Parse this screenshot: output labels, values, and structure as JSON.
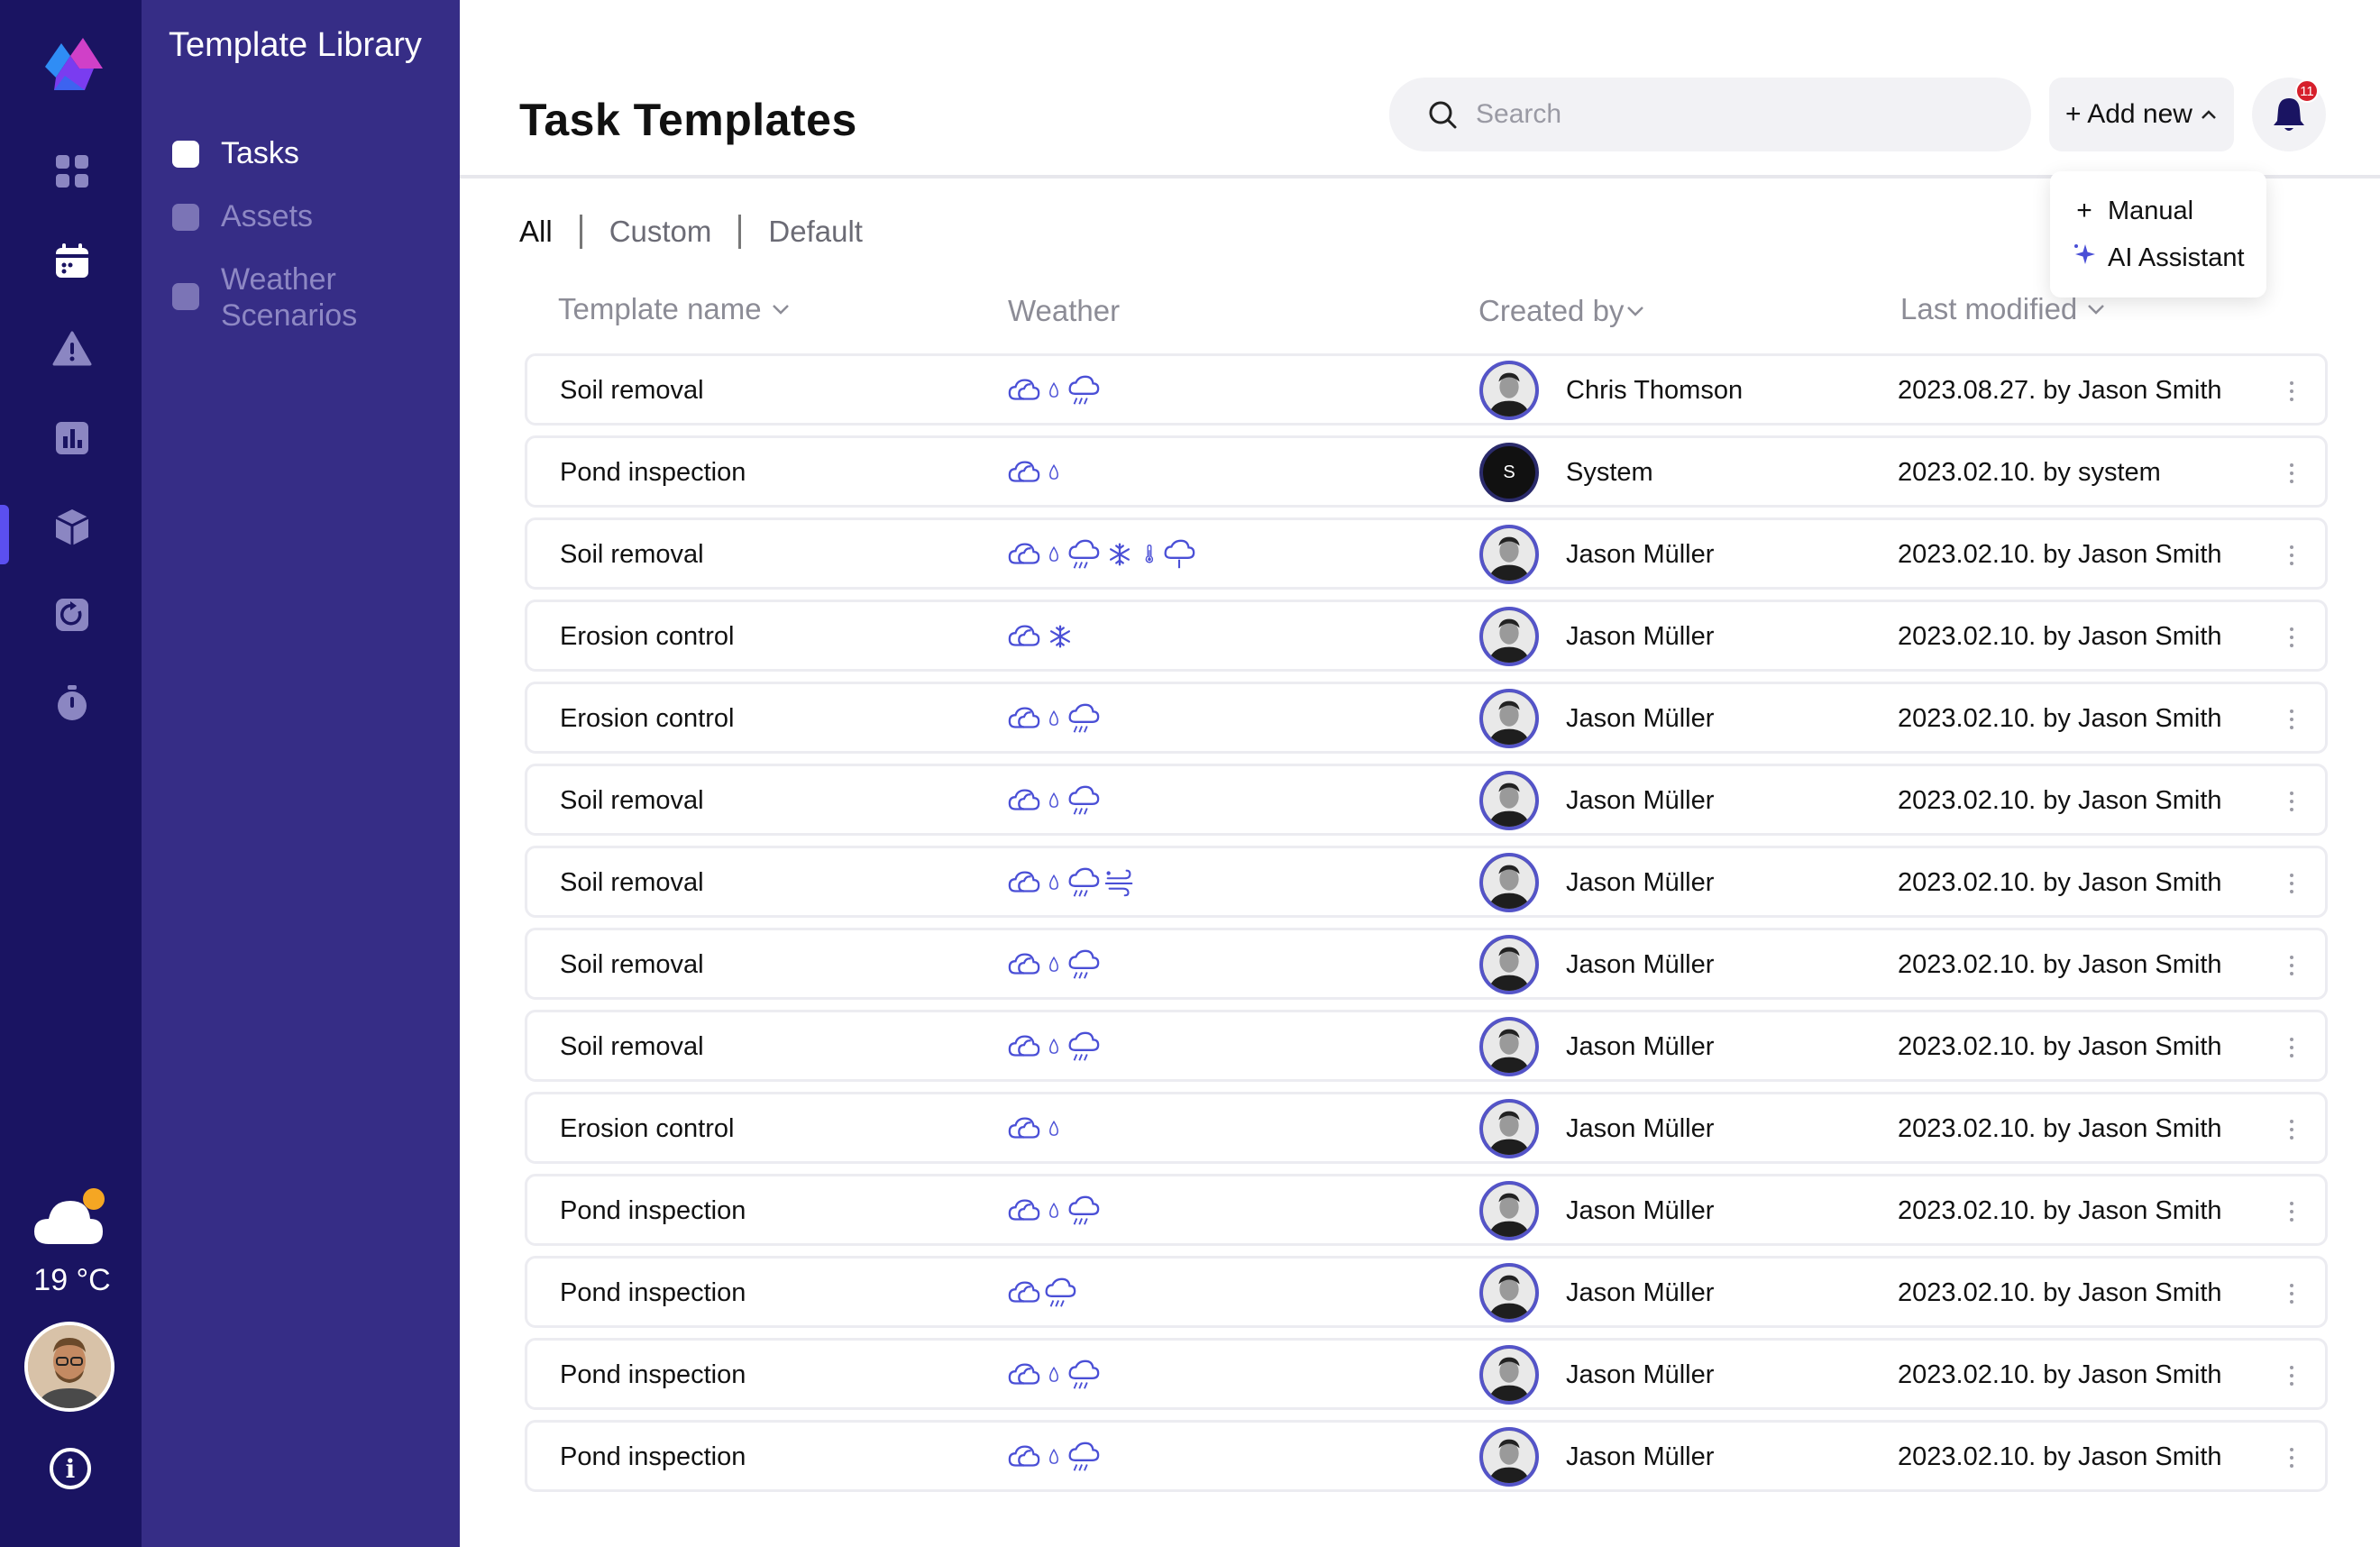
{
  "rail": {
    "nav": [
      {
        "name": "dashboard-icon"
      },
      {
        "name": "calendar-icon"
      },
      {
        "name": "warning-icon"
      },
      {
        "name": "bar-chart-icon"
      },
      {
        "name": "box-icon"
      },
      {
        "name": "history-icon"
      },
      {
        "name": "stopwatch-icon"
      }
    ],
    "active_index": 4,
    "temperature": "19 °C",
    "accent": "#5b4ff0"
  },
  "library": {
    "title": "Template Library",
    "items": [
      {
        "label": "Tasks",
        "active": true
      },
      {
        "label": "Assets",
        "active": false
      },
      {
        "label": "Weather Scenarios",
        "active": false
      }
    ]
  },
  "header": {
    "title": "Task Templates",
    "search_placeholder": "Search",
    "add_new_label": "+ Add new",
    "notification_count": "11"
  },
  "add_menu": {
    "items": [
      {
        "icon": "plus-icon",
        "label": "Manual"
      },
      {
        "icon": "sparkle-icon",
        "label": "AI Assistant"
      }
    ]
  },
  "filters": [
    {
      "label": "All",
      "active": true
    },
    {
      "label": "Custom",
      "active": false
    },
    {
      "label": "Default",
      "active": false
    }
  ],
  "table": {
    "headers": {
      "name": "Template name",
      "weather": "Weather",
      "created_by": "Created by",
      "last_modified": "Last modified"
    },
    "rows": [
      {
        "name": "Soil removal",
        "weather": [
          "cloud",
          "drop",
          "rain"
        ],
        "creator": "Chris Thomson",
        "avatar": "photo",
        "modified": "2023.08.27. by Jason Smith"
      },
      {
        "name": "Pond inspection",
        "weather": [
          "cloud",
          "drop"
        ],
        "creator": "System",
        "avatar": "S",
        "modified": "2023.02.10. by system"
      },
      {
        "name": "Soil removal",
        "weather": [
          "cloud",
          "drop",
          "rain",
          "snow",
          "thermometer",
          "hail"
        ],
        "creator": "Jason Müller",
        "avatar": "photo",
        "modified": "2023.02.10. by Jason Smith"
      },
      {
        "name": "Erosion control",
        "weather": [
          "cloud",
          "snow"
        ],
        "creator": "Jason Müller",
        "avatar": "photo",
        "modified": "2023.02.10. by Jason Smith"
      },
      {
        "name": "Erosion control",
        "weather": [
          "cloud",
          "drop",
          "rain"
        ],
        "creator": "Jason Müller",
        "avatar": "photo",
        "modified": "2023.02.10. by Jason Smith"
      },
      {
        "name": "Soil removal",
        "weather": [
          "cloud",
          "drop",
          "rain"
        ],
        "creator": "Jason Müller",
        "avatar": "photo",
        "modified": "2023.02.10. by Jason Smith"
      },
      {
        "name": "Soil removal",
        "weather": [
          "cloud",
          "drop",
          "rain",
          "wind"
        ],
        "creator": "Jason Müller",
        "avatar": "photo",
        "modified": "2023.02.10. by Jason Smith"
      },
      {
        "name": "Soil removal",
        "weather": [
          "cloud",
          "drop",
          "rain"
        ],
        "creator": "Jason Müller",
        "avatar": "photo",
        "modified": "2023.02.10. by Jason Smith"
      },
      {
        "name": "Soil removal",
        "weather": [
          "cloud",
          "drop",
          "rain"
        ],
        "creator": "Jason Müller",
        "avatar": "photo",
        "modified": "2023.02.10. by Jason Smith"
      },
      {
        "name": "Erosion control",
        "weather": [
          "cloud",
          "drop"
        ],
        "creator": "Jason Müller",
        "avatar": "photo",
        "modified": "2023.02.10. by Jason Smith"
      },
      {
        "name": "Pond inspection",
        "weather": [
          "cloud",
          "drop",
          "rain"
        ],
        "creator": "Jason Müller",
        "avatar": "photo",
        "modified": "2023.02.10. by Jason Smith"
      },
      {
        "name": "Pond inspection",
        "weather": [
          "cloud",
          "rain"
        ],
        "creator": "Jason Müller",
        "avatar": "photo",
        "modified": "2023.02.10. by Jason Smith"
      },
      {
        "name": "Pond inspection",
        "weather": [
          "cloud",
          "drop",
          "rain"
        ],
        "creator": "Jason Müller",
        "avatar": "photo",
        "modified": "2023.02.10. by Jason Smith"
      },
      {
        "name": "Pond inspection",
        "weather": [
          "cloud",
          "drop",
          "rain"
        ],
        "creator": "Jason Müller",
        "avatar": "photo",
        "modified": "2023.02.10. by Jason Smith"
      }
    ]
  },
  "colors": {
    "rail_bg": "#1a1462",
    "library_bg": "#362d86",
    "weather_icon": "#4a4fd6",
    "avatar_ring": "#5454c8",
    "badge": "#d6202c"
  }
}
